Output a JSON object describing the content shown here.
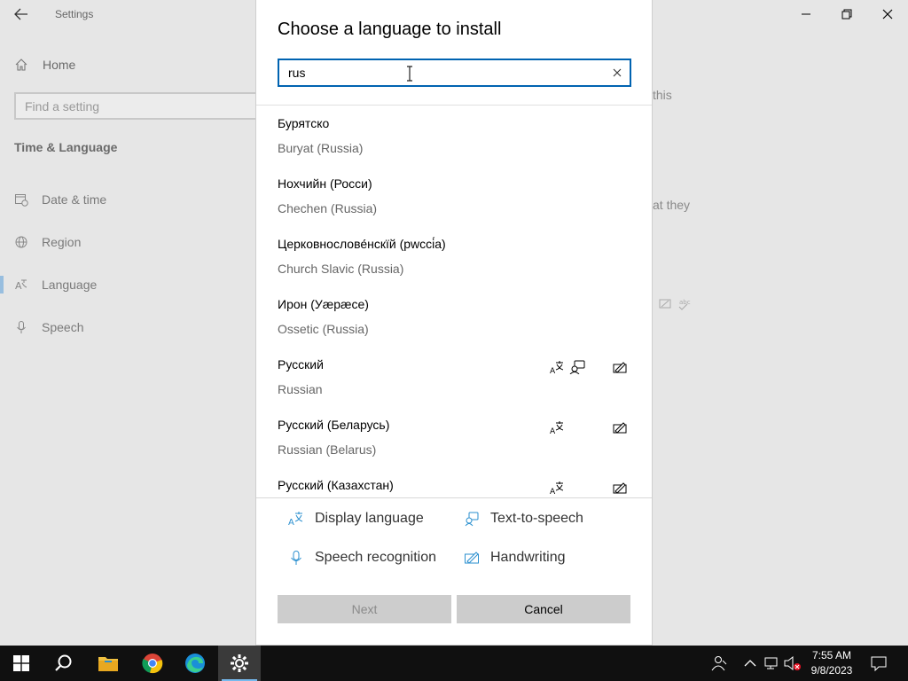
{
  "settings": {
    "app_title": "Settings",
    "nav_home": "Home",
    "find_placeholder": "Find a setting",
    "section_title": "Time & Language",
    "nav_items": [
      {
        "label": "Date & time",
        "icon": "calendar-clock-icon"
      },
      {
        "label": "Region",
        "icon": "globe-icon"
      },
      {
        "label": "Language",
        "icon": "language-icon"
      },
      {
        "label": "Speech",
        "icon": "microphone-icon"
      }
    ],
    "bg_fragments": [
      "this",
      "at they"
    ]
  },
  "dialog": {
    "title": "Choose a language to install",
    "search_value": "rus",
    "languages": [
      {
        "native": "Бурятско",
        "english": "Buryat (Russia)",
        "display": false,
        "tts": false,
        "handwriting": false
      },
      {
        "native": "Нохчийн (Росси)",
        "english": "Chechen (Russia)",
        "display": false,
        "tts": false,
        "handwriting": false
      },
      {
        "native": "Церковнослове́нскїй (рwссі́а)",
        "english": "Church Slavic (Russia)",
        "display": false,
        "tts": false,
        "handwriting": false
      },
      {
        "native": "Ирон (Уæрæсе)",
        "english": "Ossetic (Russia)",
        "display": false,
        "tts": false,
        "handwriting": false
      },
      {
        "native": "Русский",
        "english": "Russian",
        "display": true,
        "tts": true,
        "handwriting": true
      },
      {
        "native": "Русский (Беларусь)",
        "english": "Russian (Belarus)",
        "display": true,
        "tts": false,
        "handwriting": true
      },
      {
        "native": "Русский (Казахстан)",
        "english": "",
        "display": true,
        "tts": false,
        "handwriting": true
      }
    ],
    "legend": {
      "display_language": "Display language",
      "text_to_speech": "Text-to-speech",
      "speech_recognition": "Speech recognition",
      "handwriting": "Handwriting"
    },
    "next_label": "Next",
    "cancel_label": "Cancel"
  },
  "taskbar": {
    "time": "7:55 AM",
    "date": "9/8/2023"
  },
  "colors": {
    "accent": "#0063b1",
    "icon_accent": "#2a8fcf"
  }
}
